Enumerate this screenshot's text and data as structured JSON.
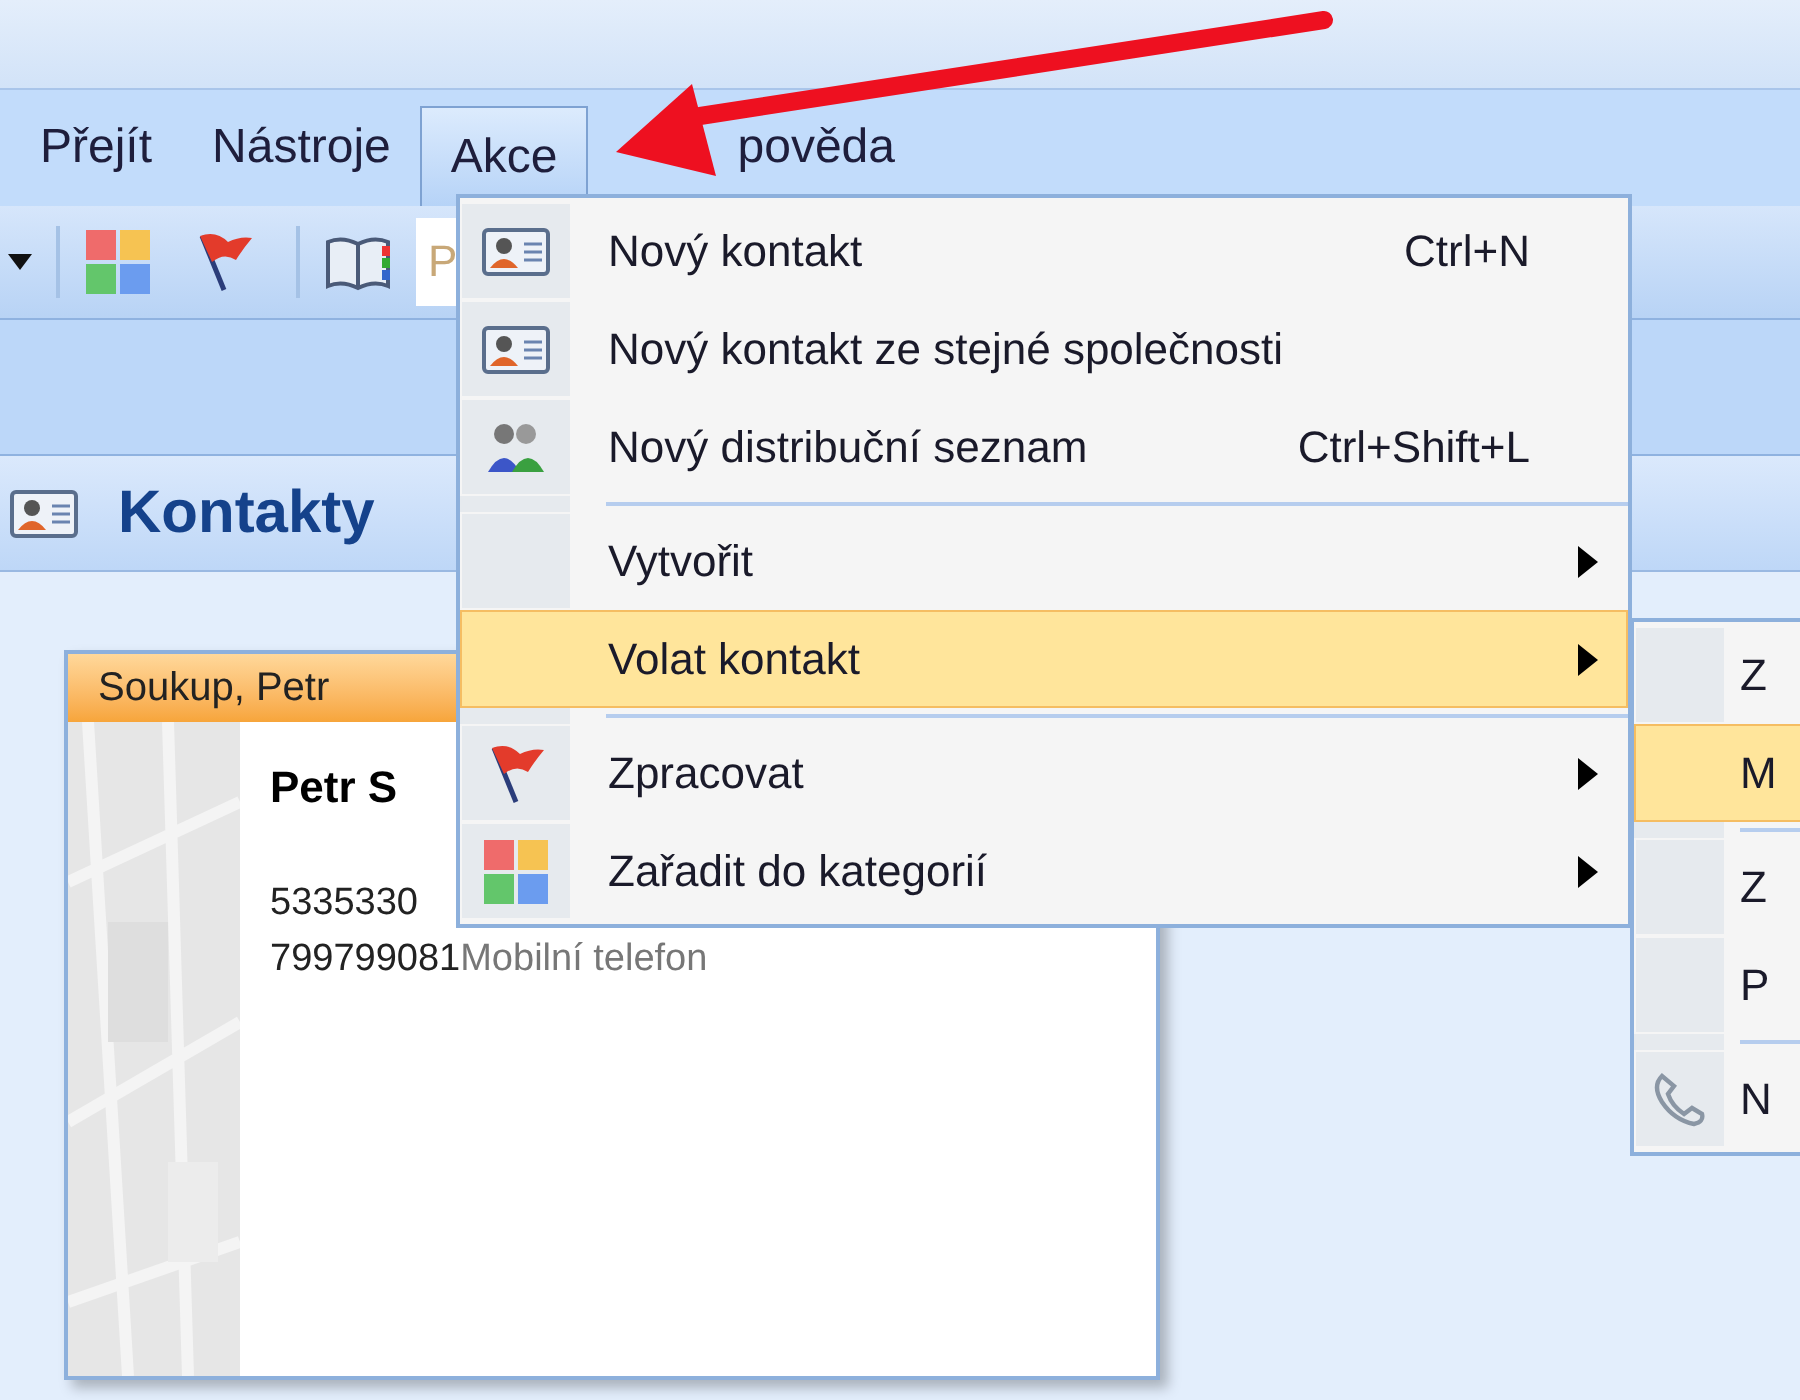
{
  "menubar": [
    {
      "label": "Přejít",
      "selected": false
    },
    {
      "label": "Nástroje",
      "selected": false
    },
    {
      "label": "Akce",
      "selected": true
    },
    {
      "label": "pověda",
      "selected": false
    }
  ],
  "search": {
    "placeholder": "P"
  },
  "folder": {
    "title": "Kontakty"
  },
  "card": {
    "header": "Soukup, Petr",
    "name": "Petr S",
    "lines": [
      {
        "number": "5335330"
      },
      {
        "number": "799799081",
        "label": "Mobilní telefon"
      }
    ]
  },
  "menu": [
    {
      "kind": "item",
      "label": "Nový kontakt",
      "shortcut": "Ctrl+N",
      "submenu": false,
      "selected": false
    },
    {
      "kind": "item",
      "label": "Nový kontakt ze stejné společnosti",
      "submenu": false,
      "selected": false
    },
    {
      "kind": "item",
      "label": "Nový distribuční seznam",
      "shortcut": "Ctrl+Shift+L",
      "submenu": false,
      "selected": false
    },
    {
      "kind": "separator"
    },
    {
      "kind": "item",
      "label": "Vytvořit",
      "submenu": true,
      "selected": false
    },
    {
      "kind": "item",
      "label": "Volat kontakt",
      "submenu": true,
      "selected": true
    },
    {
      "kind": "separator"
    },
    {
      "kind": "item",
      "label": "Zpracovat",
      "submenu": true,
      "selected": false
    },
    {
      "kind": "item",
      "label": "Zařadit do kategorií",
      "submenu": true,
      "selected": false
    }
  ],
  "submenu": [
    {
      "kind": "item",
      "label": "Z",
      "selected": false
    },
    {
      "kind": "item",
      "label": "M",
      "selected": true
    },
    {
      "kind": "separator"
    },
    {
      "kind": "item",
      "label": "Z",
      "selected": false
    },
    {
      "kind": "item",
      "label": "P",
      "selected": false
    },
    {
      "kind": "separator"
    },
    {
      "kind": "item",
      "label": "N",
      "selected": false
    }
  ]
}
